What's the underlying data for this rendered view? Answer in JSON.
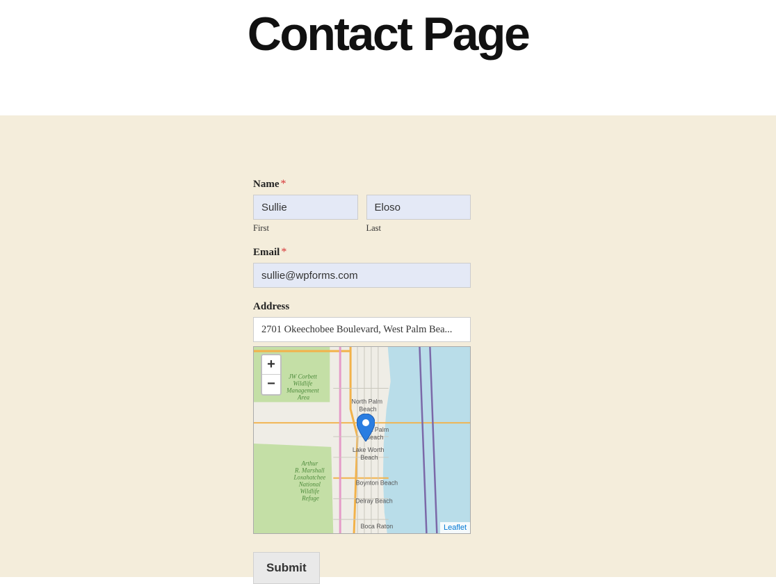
{
  "header": {
    "title": "Contact Page"
  },
  "form": {
    "name": {
      "label": "Name",
      "required_mark": "*",
      "first_label": "First",
      "last_label": "Last",
      "first_value": "Sullie",
      "last_value": "Eloso"
    },
    "email": {
      "label": "Email",
      "required_mark": "*",
      "value": "sullie@wpforms.com"
    },
    "address": {
      "label": "Address",
      "value": "2701 Okeechobee Boulevard, West Palm Bea..."
    },
    "submit_label": "Submit"
  },
  "map": {
    "zoom_in_glyph": "+",
    "zoom_out_glyph": "−",
    "attribution": "Leaflet",
    "places": {
      "corbett": "JW Corbett Wildlife Management Area",
      "loxahatchee1": "Arthur R. Marshall Loxahatchee National Wildlife Refuge",
      "north_palm": "North Palm Beach",
      "west_palm": "West Palm Beach",
      "lake_worth": "Lake Worth Beach",
      "boynton": "Boynton Beach",
      "delray": "Delray Beach",
      "boca": "Boca Raton"
    }
  }
}
